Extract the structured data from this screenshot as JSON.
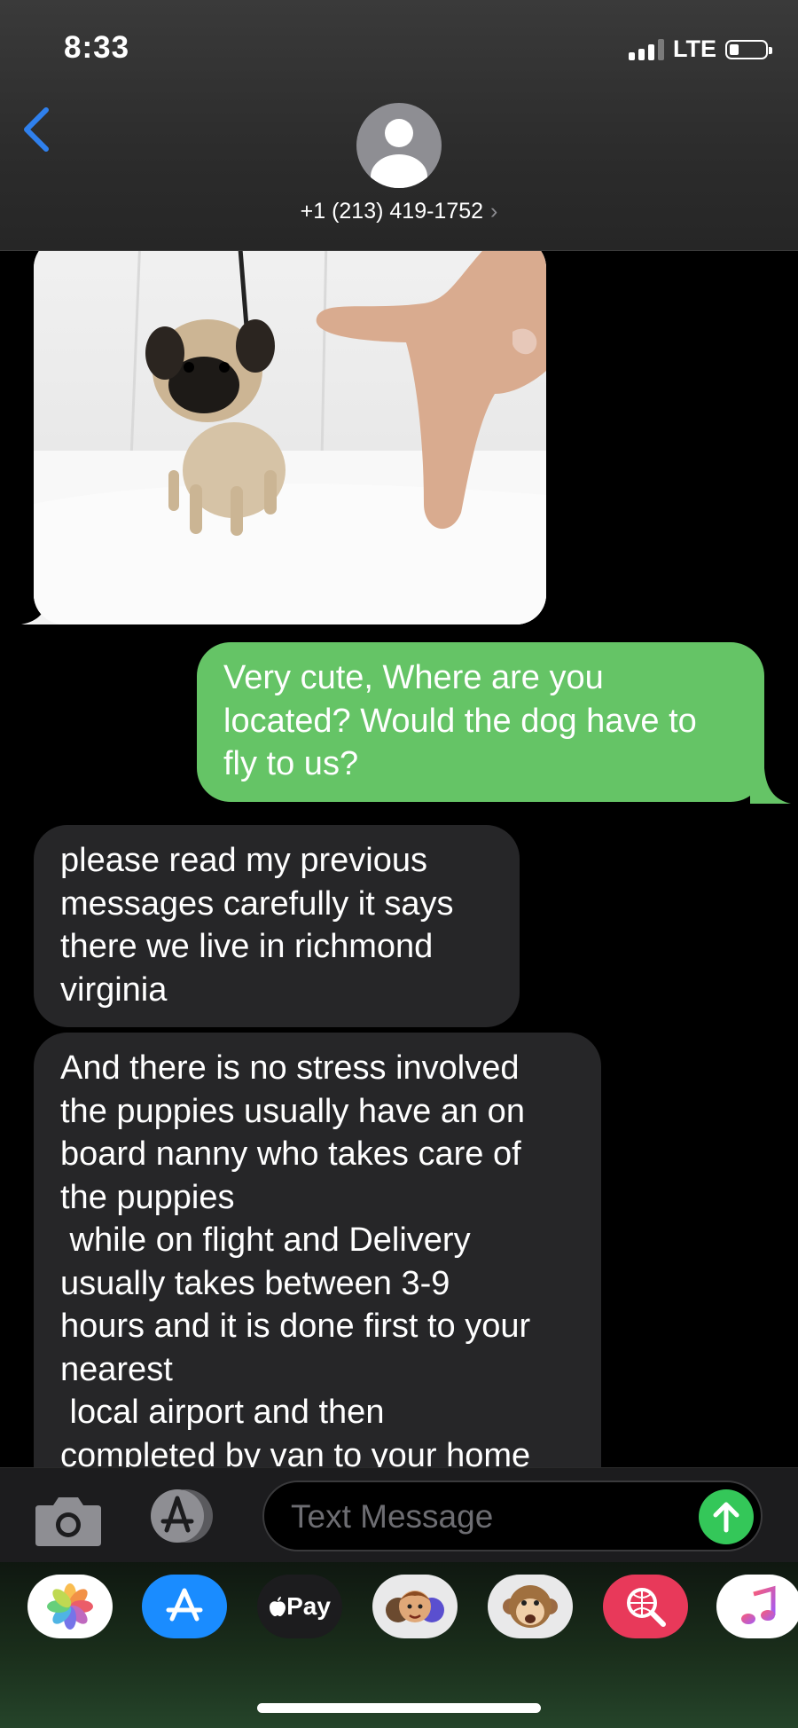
{
  "status_bar": {
    "time": "8:33",
    "network": "LTE",
    "battery_level": 0.2
  },
  "header": {
    "contact_number": "+1 (213) 419-1752",
    "contact_chevron": "›"
  },
  "messages": {
    "sent_1": [
      "Very cute, Where are you",
      "located? Would the dog have to",
      "fly to us?"
    ],
    "received_1": [
      "please read my previous",
      "messages carefully it says",
      "there we live in richmond",
      "virginia"
    ],
    "received_2": [
      "And there is no stress involved",
      "the puppies usually have an on",
      "board nanny who takes care of",
      "the puppies",
      " while on flight and Delivery",
      "usually takes between 3-9",
      "hours and it is done first to your",
      "nearest",
      " local airport and then",
      "completed by van to your home"
    ]
  },
  "composer": {
    "placeholder": "Text Message"
  },
  "app_drawer": {
    "apple_pay_label": "Pay",
    "icons": [
      "photos-icon",
      "app-store-icon",
      "apple-pay-icon",
      "memoji-icon",
      "animoji-icon",
      "web-search-icon",
      "music-icon"
    ]
  },
  "colors": {
    "sent_bubble": "#65c466",
    "received_bubble": "#262628",
    "accent_blue": "#2f80ed",
    "send_button": "#34c759"
  }
}
